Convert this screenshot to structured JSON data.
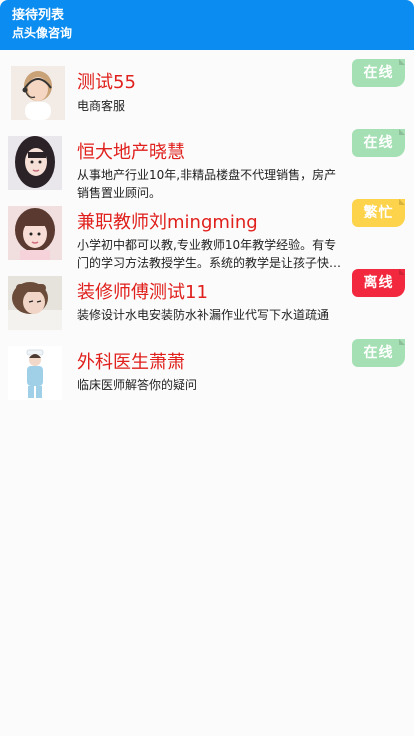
{
  "header": {
    "title": "接待列表",
    "subtitle": "点头像咨询"
  },
  "agents": [
    {
      "name": "测试55",
      "desc": "电商客服",
      "status": "在线",
      "status_type": "online",
      "avatar": "avatar-headset-woman-icon"
    },
    {
      "name": "恒大地产晓慧",
      "desc": "从事地产行业10年,非精品楼盘不代理销售，房产销售置业顾问。",
      "status": "在线",
      "status_type": "online",
      "avatar": "avatar-woman-portrait-icon"
    },
    {
      "name": "兼职教师刘mingming",
      "desc": "小学初中都可以教,专业教师10年教学经验。有专门的学习方法教授学生。系统的教学是让孩子快乐学习的关键。",
      "status": "繁忙",
      "status_type": "busy",
      "avatar": "avatar-girl-portrait-icon"
    },
    {
      "name": "装修师傅测试11",
      "desc": "装修设计水电安装防水补漏作业代写下水道疏通",
      "status": "离线",
      "status_type": "offline",
      "avatar": "avatar-woman-lying-icon"
    },
    {
      "name": "外科医生萧萧",
      "desc": "临床医师解答你的疑问",
      "status": "在线",
      "status_type": "online",
      "avatar": "avatar-nurse-icon"
    }
  ],
  "colors": {
    "header": "#0a8cf0",
    "name": "#e0201c",
    "online": "#a5e0b4",
    "busy": "#fcd34a",
    "offline": "#f2293e"
  }
}
